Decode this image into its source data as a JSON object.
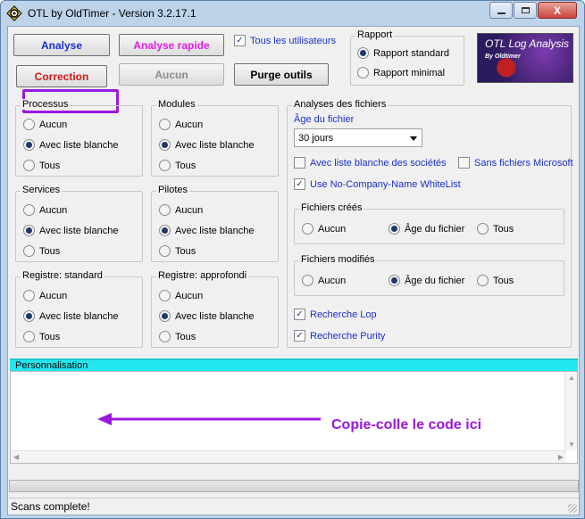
{
  "window": {
    "title": "OTL by OldTimer - Version 3.2.17.1",
    "icon": "gear-diamond-icon",
    "controls": {
      "minimize": "minimize-icon",
      "maximize": "maximize-icon",
      "close_label": "X"
    }
  },
  "toolbar": {
    "analyse": "Analyse",
    "analyse_rapide": "Analyse rapide",
    "correction": "Correction",
    "aucun": "Aucun",
    "purge_outils": "Purge outils",
    "tous_utilisateurs": "Tous les utilisateurs",
    "colors": {
      "analyse": "#1a2fcc",
      "analyse_rapide": "#e020e0",
      "correction": "#d01818",
      "highlight": "#9a18e0"
    }
  },
  "rapport": {
    "title": "Rapport",
    "standard": "Rapport standard",
    "minimal": "Rapport minimal",
    "selected": "standard"
  },
  "logo": {
    "title": "OTL Log Analysis",
    "subtitle": "By Oldtimer"
  },
  "groups": {
    "processus": {
      "title": "Processus",
      "options": [
        "Aucun",
        "Avec liste blanche",
        "Tous"
      ],
      "selected": 1
    },
    "modules": {
      "title": "Modules",
      "options": [
        "Aucun",
        "Avec liste blanche",
        "Tous"
      ],
      "selected": 1
    },
    "services": {
      "title": "Services",
      "options": [
        "Aucun",
        "Avec liste blanche",
        "Tous"
      ],
      "selected": 1
    },
    "pilotes": {
      "title": "Pilotes",
      "options": [
        "Aucun",
        "Avec liste blanche",
        "Tous"
      ],
      "selected": 1
    },
    "registre_standard": {
      "title": "Registre: standard",
      "options": [
        "Aucun",
        "Avec liste blanche",
        "Tous"
      ],
      "selected": 1
    },
    "registre_approfondi": {
      "title": "Registre: approfondi",
      "options": [
        "Aucun",
        "Avec liste blanche",
        "Tous"
      ],
      "selected": 1
    }
  },
  "analyses": {
    "title": "Analyses des fichiers",
    "age_label": "Âge du fichier",
    "age_value": "30 jours",
    "whitelist_companies": "Avec liste blanche des sociétés",
    "sans_fichiers": "Sans fichiers Microsoft",
    "no_company": "Use No-Company-Name WhiteList",
    "crees": {
      "title": "Fichiers créés",
      "options": [
        "Aucun",
        "Âge du fichier",
        "Tous"
      ],
      "selected": 1
    },
    "modifies": {
      "title": "Fichiers modifiés",
      "options": [
        "Aucun",
        "Âge du fichier",
        "Tous"
      ],
      "selected": 1
    },
    "recherche_lop": "Recherche Lop",
    "recherche_purity": "Recherche Purity"
  },
  "personnalisation": {
    "label": "Personnalisation",
    "annotation": "Copie-colle le code ici"
  },
  "status": {
    "text": "Scans complete!"
  }
}
